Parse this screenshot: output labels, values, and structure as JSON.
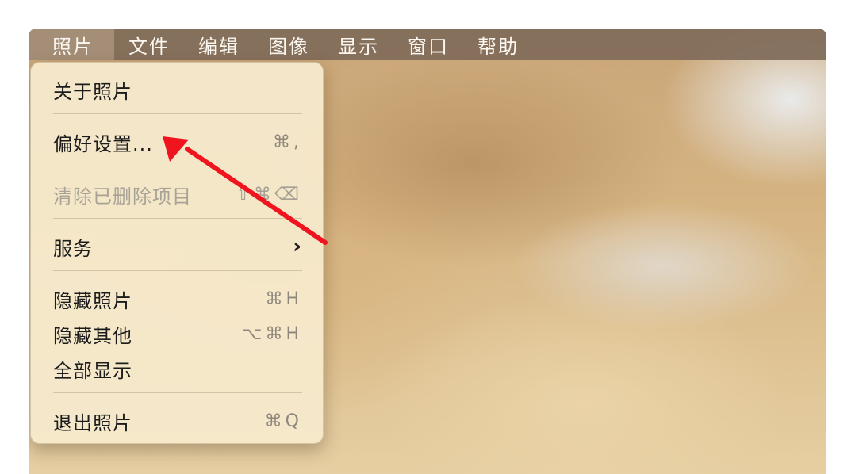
{
  "menubar": {
    "items": [
      {
        "label": "照片"
      },
      {
        "label": "文件"
      },
      {
        "label": "编辑"
      },
      {
        "label": "图像"
      },
      {
        "label": "显示"
      },
      {
        "label": "窗口"
      },
      {
        "label": "帮助"
      }
    ]
  },
  "app_menu": {
    "items": [
      {
        "label": "关于照片",
        "shortcut": ""
      },
      {
        "label": "偏好设置...",
        "shortcut": "⌘,"
      },
      {
        "label": "清除已删除项目",
        "shortcut": "⇧⌘⌫"
      },
      {
        "label": "服务",
        "shortcut": ""
      },
      {
        "label": "隐藏照片",
        "shortcut": "⌘H"
      },
      {
        "label": "隐藏其他",
        "shortcut": "⌥⌘H"
      },
      {
        "label": "全部显示",
        "shortcut": ""
      },
      {
        "label": "退出照片",
        "shortcut": "⌘Q"
      }
    ],
    "submenu_indicator": "›"
  },
  "colors": {
    "menubar_bg": "#806c5a",
    "menu_bg": "#f6ebcd",
    "annotation_arrow": "#f0141e"
  },
  "annotation": {
    "icon": "arrow-pointer-icon"
  }
}
